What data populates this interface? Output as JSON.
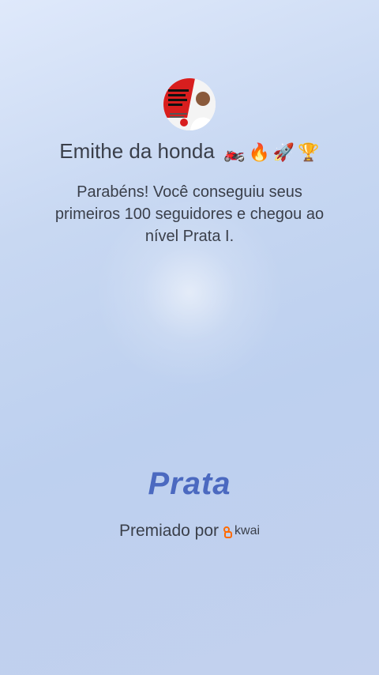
{
  "profile": {
    "name": "Emithe da honda",
    "emojis": [
      "🏍️",
      "🔥",
      "🚀",
      "🏆"
    ]
  },
  "message": "Parabéns! Você conseguiu seus primeiros 100 seguidores e chegou ao nível Prata I.",
  "level": "Prata",
  "awarded": {
    "label": "Premiado por",
    "brand": "kwai"
  },
  "colors": {
    "level": "#4b69c0",
    "brand": "#ff6a00",
    "text": "#3a3f4a"
  }
}
